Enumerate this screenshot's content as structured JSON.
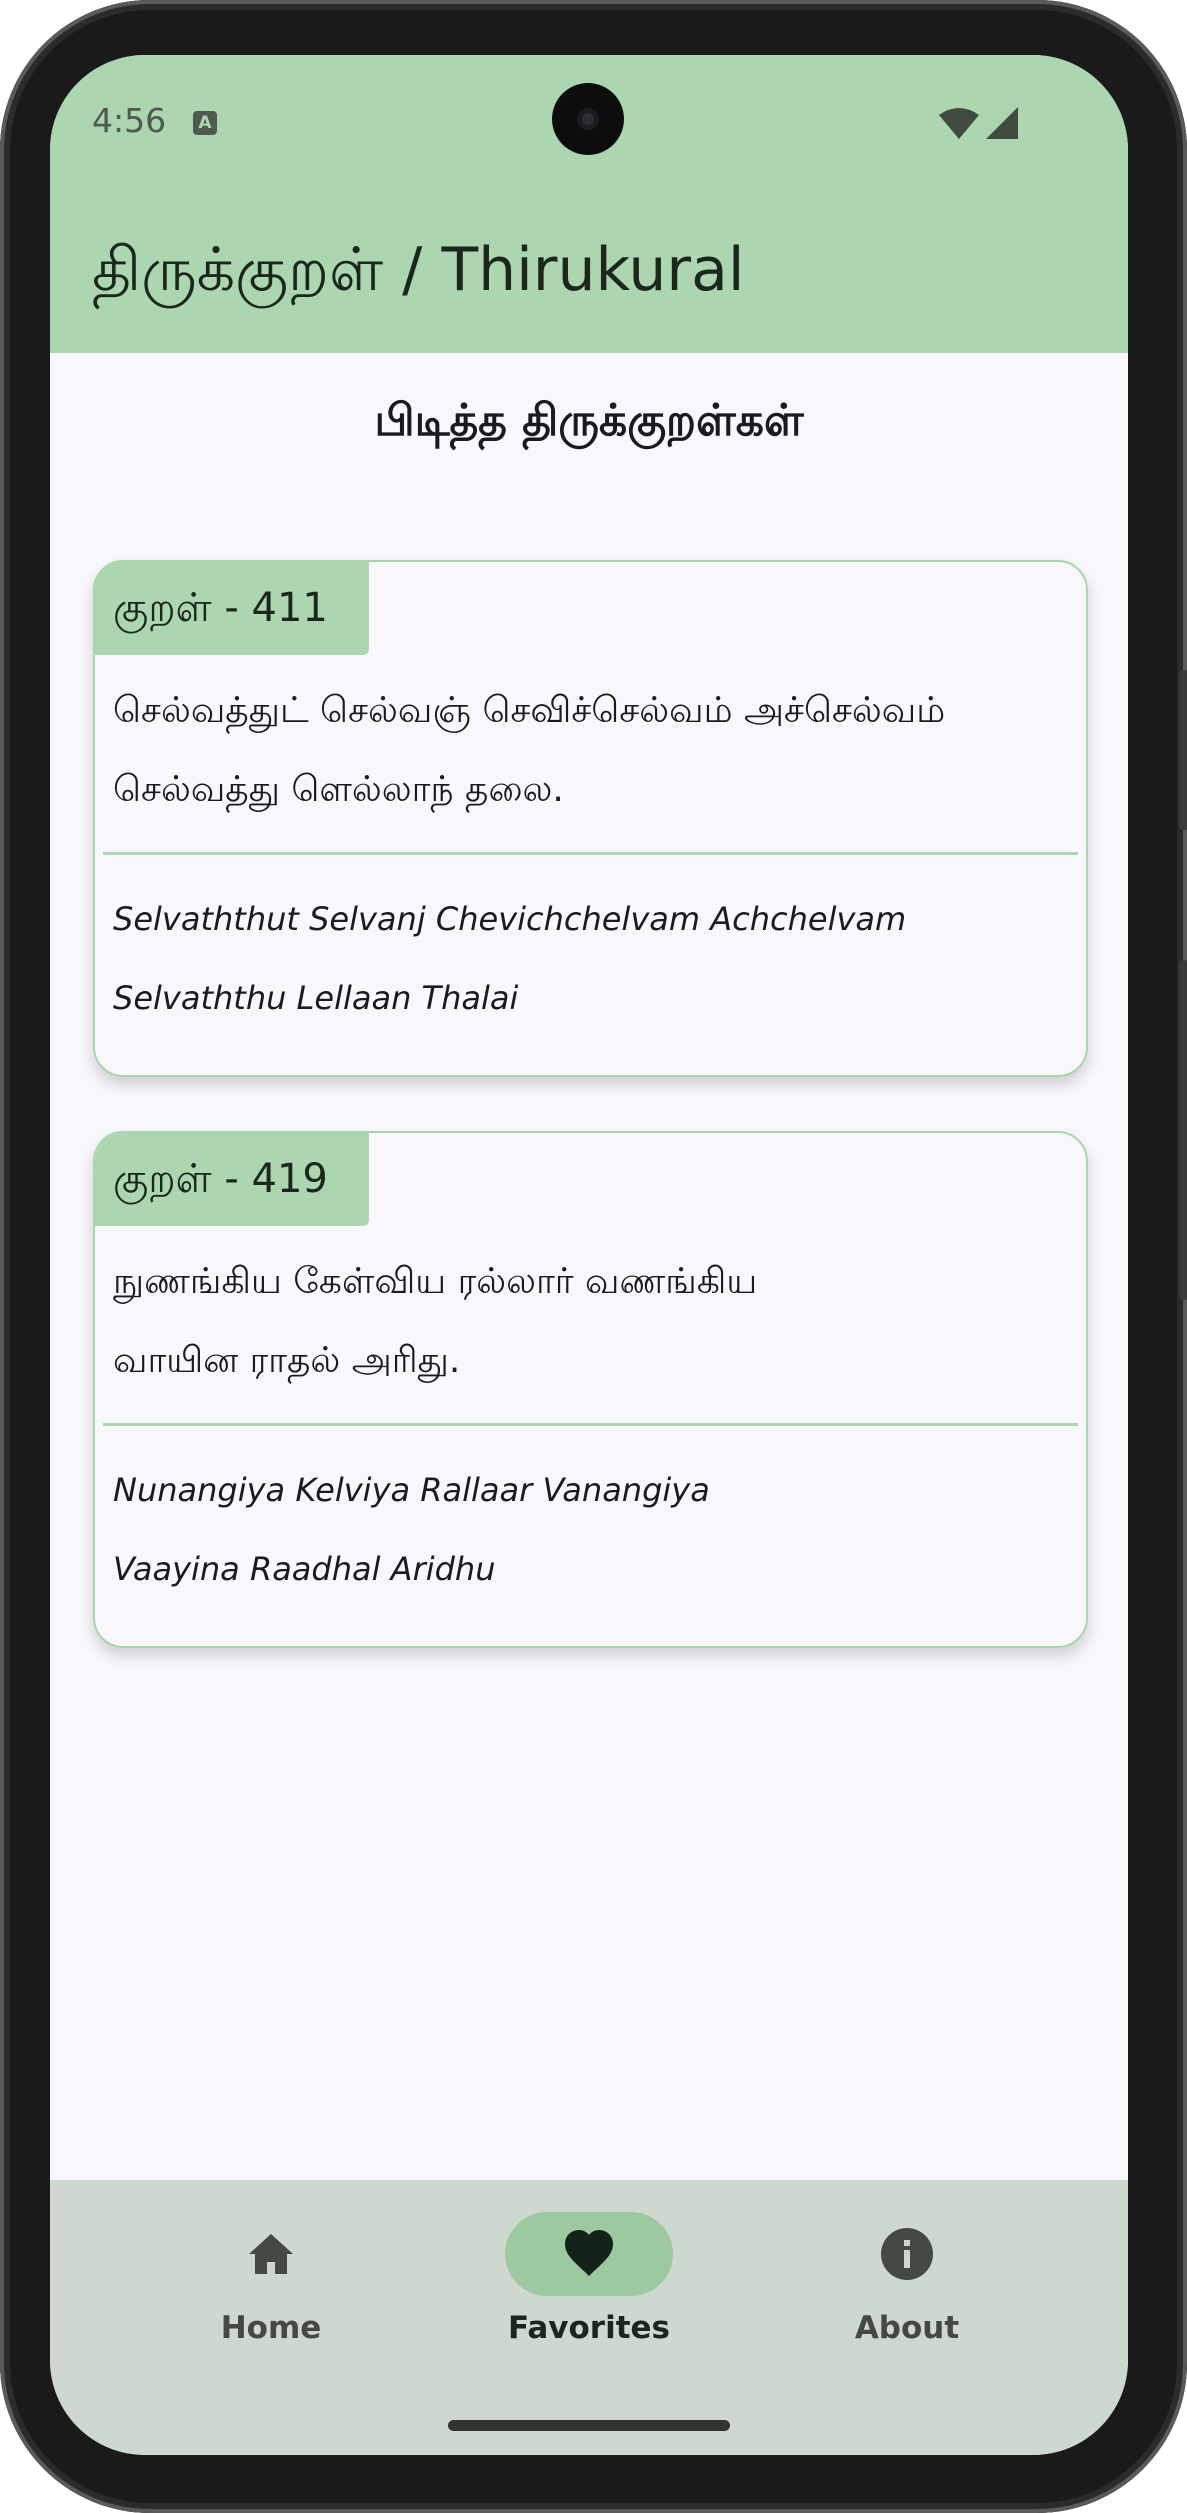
{
  "status_bar": {
    "time": "4:56",
    "notification_icon": "A",
    "icons": [
      "wifi-icon",
      "signal-icon"
    ]
  },
  "app_bar": {
    "title": "திருக்குறள் / Thirukural"
  },
  "page": {
    "heading": "பிடித்த திருக்குறள்கள்"
  },
  "favorites": [
    {
      "badge": "குறள் - 411",
      "tamil_line1": "செல்வத்துட் செல்வஞ் செவிச்செல்வம் அச்செல்வம்",
      "tamil_line2": "செல்வத்து ளெல்லாந் தலை.",
      "translit_line1": "Selvaththut Selvanj Chevichchelvam Achchelvam",
      "translit_line2": "Selvaththu Lellaan Thalai"
    },
    {
      "badge": "குறள் - 419",
      "tamil_line1": "நுணங்கிய கேள்விய ரல்லார் வணங்கிய",
      "tamil_line2": "வாயின ராதல் அரிது.",
      "translit_line1": "Nunangiya Kelviya Rallaar Vanangiya",
      "translit_line2": "Vaayina Raadhal Aridhu"
    }
  ],
  "bottom_nav": {
    "items": [
      {
        "label": "Home",
        "icon": "home-icon",
        "active": false
      },
      {
        "label": "Favorites",
        "icon": "heart-icon",
        "active": true
      },
      {
        "label": "About",
        "icon": "info-icon",
        "active": false
      }
    ]
  },
  "colors": {
    "app_bar": "#acd6b0",
    "card_border": "#a9d5ad",
    "nav_background": "#cfd8cf",
    "nav_active_indicator": "#9cc99f",
    "background": "#f8f7fc"
  }
}
